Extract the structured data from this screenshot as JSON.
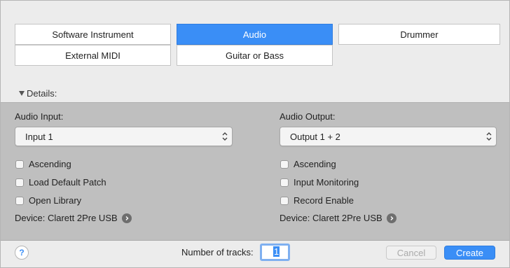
{
  "track_types": [
    {
      "label": "Software Instrument",
      "selected": false
    },
    {
      "label": "Audio",
      "selected": true
    },
    {
      "label": "Drummer",
      "selected": false
    },
    {
      "label": "External MIDI",
      "selected": false
    },
    {
      "label": "Guitar or Bass",
      "selected": false
    }
  ],
  "details": {
    "toggle_label": "Details:",
    "input": {
      "label": "Audio Input:",
      "value": "Input 1",
      "checkboxes": [
        {
          "label": "Ascending",
          "checked": false
        },
        {
          "label": "Load Default Patch",
          "checked": false
        },
        {
          "label": "Open Library",
          "checked": false
        }
      ],
      "device": "Device: Clarett 2Pre USB"
    },
    "output": {
      "label": "Audio Output:",
      "value": "Output 1 + 2",
      "checkboxes": [
        {
          "label": "Ascending",
          "checked": false
        },
        {
          "label": "Input Monitoring",
          "checked": false
        },
        {
          "label": "Record Enable",
          "checked": false
        }
      ],
      "device": "Device: Clarett 2Pre USB"
    }
  },
  "footer": {
    "help_label": "?",
    "tracks_label": "Number of tracks:",
    "tracks_value": "1",
    "cancel_label": "Cancel",
    "create_label": "Create"
  },
  "colors": {
    "accent": "#3a8ef6",
    "panel": "#bfbfbf",
    "background": "#ececec"
  }
}
